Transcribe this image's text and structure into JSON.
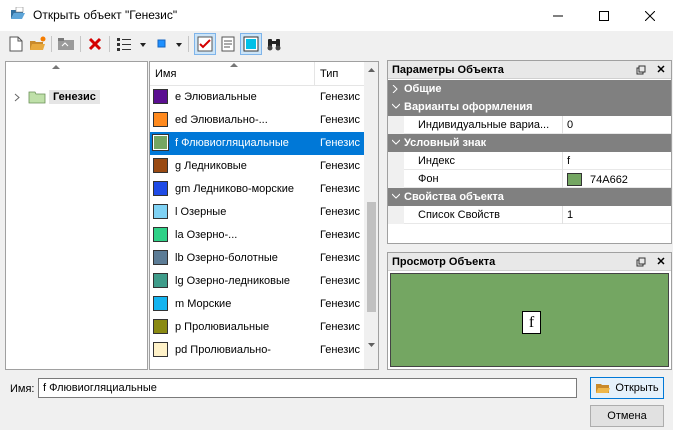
{
  "window": {
    "title": "Открыть объект \"Генезис\""
  },
  "tree": {
    "items": [
      {
        "label": "Генезис",
        "icon": "folder-icon"
      }
    ]
  },
  "list": {
    "columns": {
      "name": "Имя",
      "type": "Тип"
    },
    "rows": [
      {
        "name": "e Элювиальные",
        "type": "Генезис",
        "color": "#5B0F91"
      },
      {
        "name": "ed Элювиально-...",
        "type": "Генезис",
        "color": "#FF8A1E"
      },
      {
        "name": "f Флювиогляциальные",
        "type": "Генезис",
        "color": "#74A662",
        "selected": true
      },
      {
        "name": "g Ледниковые",
        "type": "Генезис",
        "color": "#9A4A12"
      },
      {
        "name": "gm Ледниково-морские",
        "type": "Генезис",
        "color": "#1F4BE6"
      },
      {
        "name": "l Озерные",
        "type": "Генезис",
        "color": "#7FD2F4"
      },
      {
        "name": "la Озерно-...",
        "type": "Генезис",
        "color": "#2FD187"
      },
      {
        "name": "lb Озерно-болотные",
        "type": "Генезис",
        "color": "#5C7C96"
      },
      {
        "name": "lg Озерно-ледниковые",
        "type": "Генезис",
        "color": "#3F9C8A"
      },
      {
        "name": "m Морские",
        "type": "Генезис",
        "color": "#14B4F0"
      },
      {
        "name": "p Пролювиальные",
        "type": "Генезис",
        "color": "#8A8A12"
      },
      {
        "name": "pd Пролювиально-",
        "type": "Генезис",
        "color": "#FFF2C8"
      }
    ]
  },
  "properties": {
    "title": "Параметры Объекта",
    "categories": {
      "general": "Общие",
      "design": "Варианты оформления",
      "symbol": "Условный знак",
      "props": "Свойства объекта"
    },
    "rows": {
      "individual_key": "Индивидуальные вариа...",
      "individual_val": "0",
      "index_key": "Индекс",
      "index_val": "f",
      "bg_key": "Фон",
      "bg_val": "74A662",
      "list_key": "Список Свойств",
      "list_val": "1"
    }
  },
  "preview": {
    "title": "Просмотр Объекта",
    "glyph": "f",
    "background_color": "#74A662"
  },
  "bottom": {
    "name_label": "Имя:",
    "name_value": "f Флювиогляциальные",
    "open_label": "Открыть",
    "cancel_label": "Отмена"
  }
}
